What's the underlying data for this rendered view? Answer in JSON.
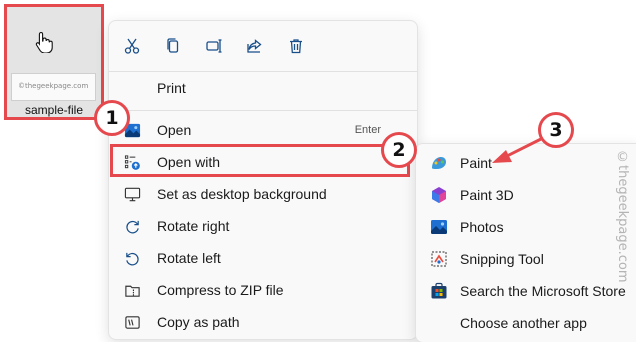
{
  "file": {
    "name": "sample-file",
    "thumbnail_text": "©thegeekpage.com"
  },
  "context_menu": {
    "toolbar": [
      {
        "icon": "cut-icon"
      },
      {
        "icon": "copy-icon"
      },
      {
        "icon": "rename-icon"
      },
      {
        "icon": "share-icon"
      },
      {
        "icon": "delete-icon"
      }
    ],
    "items": [
      {
        "label": "Print",
        "icon": "",
        "shortcut": ""
      },
      {
        "label": "Open",
        "icon": "image-icon",
        "shortcut": "Enter"
      },
      {
        "label": "Open with",
        "icon": "open-with-icon",
        "shortcut": "",
        "has_submenu": true
      },
      {
        "label": "Set as desktop background",
        "icon": "desktop-background-icon",
        "shortcut": ""
      },
      {
        "label": "Rotate right",
        "icon": "rotate-right-icon",
        "shortcut": ""
      },
      {
        "label": "Rotate left",
        "icon": "rotate-left-icon",
        "shortcut": ""
      },
      {
        "label": "Compress to ZIP file",
        "icon": "zip-icon",
        "shortcut": ""
      },
      {
        "label": "Copy as path",
        "icon": "copy-path-icon",
        "shortcut": ""
      }
    ]
  },
  "submenu": {
    "items": [
      {
        "label": "Paint",
        "icon": "paint-icon"
      },
      {
        "label": "Paint 3D",
        "icon": "paint3d-icon"
      },
      {
        "label": "Photos",
        "icon": "photos-icon"
      },
      {
        "label": "Snipping Tool",
        "icon": "snipping-tool-icon"
      },
      {
        "label": "Search the Microsoft Store",
        "icon": "store-icon"
      },
      {
        "label": "Choose another app",
        "icon": ""
      }
    ]
  },
  "callouts": [
    "1",
    "2",
    "3"
  ],
  "watermark": "©thegeekpage.com",
  "colors": {
    "highlight": "#e5494d",
    "menu_bg": "#f9f9f9",
    "accent": "#0067c0"
  }
}
